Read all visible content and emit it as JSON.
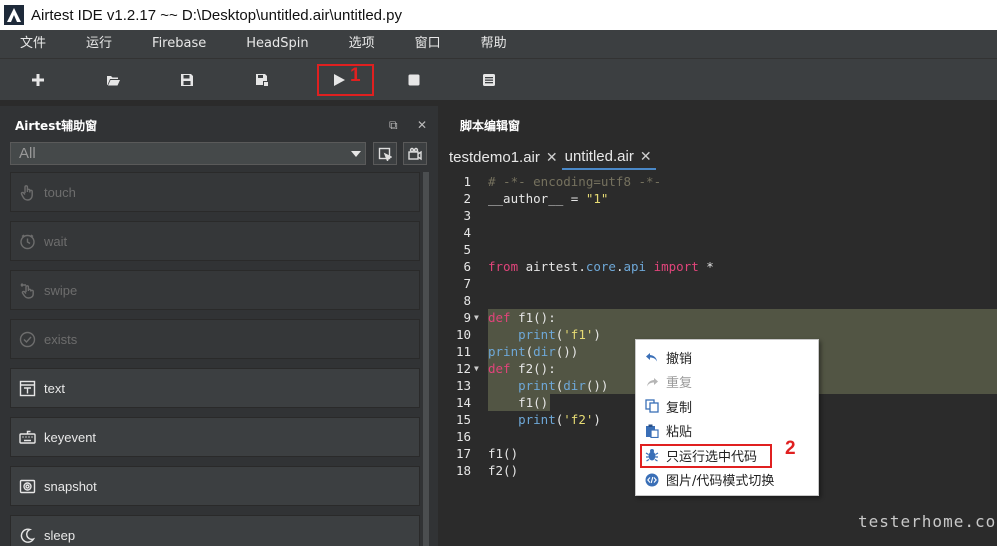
{
  "window": {
    "title": "Airtest IDE v1.2.17 ~~ D:\\Desktop\\untitled.air\\untitled.py"
  },
  "menu": [
    "文件",
    "运行",
    "Firebase",
    "HeadSpin",
    "选项",
    "窗口",
    "帮助"
  ],
  "toolbar": {
    "icons": [
      "plus-icon",
      "folder-open-icon",
      "save-icon",
      "save-as-icon",
      "play-icon",
      "stop-icon",
      "log-icon"
    ],
    "annotation_1": "1"
  },
  "left_panel": {
    "title": "Airtest辅助窗",
    "filter_value": "All",
    "commands": [
      {
        "label": "touch",
        "icon": "hand-pointer-icon",
        "enabled": false
      },
      {
        "label": "wait",
        "icon": "clock-icon",
        "enabled": false
      },
      {
        "label": "swipe",
        "icon": "swipe-hand-icon",
        "enabled": false
      },
      {
        "label": "exists",
        "icon": "check-circle-icon",
        "enabled": false
      },
      {
        "label": "text",
        "icon": "text-box-icon",
        "enabled": true
      },
      {
        "label": "keyevent",
        "icon": "keyboard-icon",
        "enabled": true
      },
      {
        "label": "snapshot",
        "icon": "camera-icon",
        "enabled": true
      },
      {
        "label": "sleep",
        "icon": "moon-icon",
        "enabled": true
      }
    ]
  },
  "editor": {
    "title": "脚本编辑窗",
    "tabs": [
      {
        "label": "testdemo1.air",
        "active": false
      },
      {
        "label": "untitled.air",
        "active": true
      }
    ],
    "lines": [
      "# -*- encoding=utf8 -*-",
      "__author__ = \"1\"",
      "",
      "",
      "",
      "from airtest.core.api import *",
      "",
      "",
      "def f1():",
      "    print('f1')",
      "print(dir())",
      "def f2():",
      "    print(dir())",
      "    f1()",
      "    print('f2')",
      "",
      "f1()",
      "f2()"
    ]
  },
  "context_menu": {
    "items": [
      {
        "label": "撤销",
        "icon": "undo-icon",
        "enabled": true
      },
      {
        "label": "重复",
        "icon": "redo-icon",
        "enabled": false
      },
      {
        "label": "复制",
        "icon": "copy-icon",
        "enabled": true
      },
      {
        "label": "粘贴",
        "icon": "paste-icon",
        "enabled": true
      },
      {
        "label": "只运行选中代码",
        "icon": "bug-run-icon",
        "enabled": true
      },
      {
        "label": "图片/代码模式切换",
        "icon": "code-toggle-icon",
        "enabled": true
      }
    ],
    "annotation_2": "2"
  },
  "colors": {
    "accent": "#4a88c7",
    "annotation": "#e02020",
    "selection": "#525544"
  },
  "watermark": "testerhome.com"
}
